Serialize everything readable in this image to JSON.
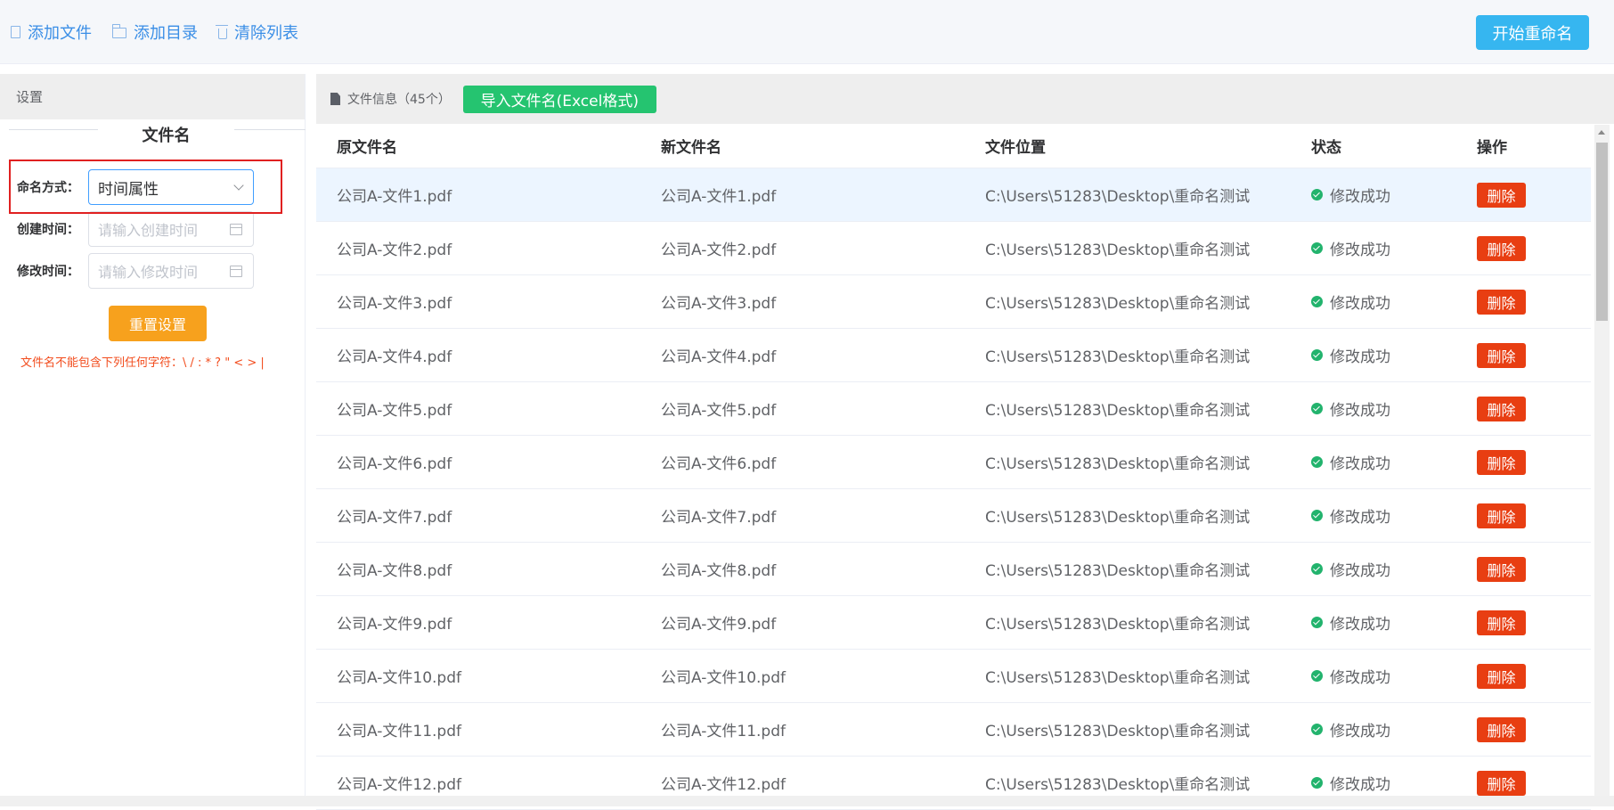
{
  "toolbar": {
    "add_file": "添加文件",
    "add_dir": "添加目录",
    "clear_list": "清除列表",
    "start_rename": "开始重命名"
  },
  "settings": {
    "title": "设置",
    "section_title": "文件名",
    "naming_label": "命名方式：",
    "naming_value": "时间属性",
    "create_time_label": "创建时间：",
    "create_time_placeholder": "请输入创建时间",
    "modify_time_label": "修改时间：",
    "modify_time_placeholder": "请输入修改时间",
    "reset_button": "重置设置",
    "warning": "文件名不能包含下列任何字符：\\ / : * ? \" < > |"
  },
  "file_panel": {
    "title": "文件信息（45个）",
    "import_button": "导入文件名(Excel格式)"
  },
  "table": {
    "headers": [
      "原文件名",
      "新文件名",
      "文件位置",
      "状态",
      "操作"
    ],
    "rows": [
      {
        "original": "公司A-文件1.pdf",
        "new": "公司A-文件1.pdf",
        "location": "C:\\Users\\51283\\Desktop\\重命名测试",
        "status": "修改成功",
        "action": "删除"
      },
      {
        "original": "公司A-文件2.pdf",
        "new": "公司A-文件2.pdf",
        "location": "C:\\Users\\51283\\Desktop\\重命名测试",
        "status": "修改成功",
        "action": "删除"
      },
      {
        "original": "公司A-文件3.pdf",
        "new": "公司A-文件3.pdf",
        "location": "C:\\Users\\51283\\Desktop\\重命名测试",
        "status": "修改成功",
        "action": "删除"
      },
      {
        "original": "公司A-文件4.pdf",
        "new": "公司A-文件4.pdf",
        "location": "C:\\Users\\51283\\Desktop\\重命名测试",
        "status": "修改成功",
        "action": "删除"
      },
      {
        "original": "公司A-文件5.pdf",
        "new": "公司A-文件5.pdf",
        "location": "C:\\Users\\51283\\Desktop\\重命名测试",
        "status": "修改成功",
        "action": "删除"
      },
      {
        "original": "公司A-文件6.pdf",
        "new": "公司A-文件6.pdf",
        "location": "C:\\Users\\51283\\Desktop\\重命名测试",
        "status": "修改成功",
        "action": "删除"
      },
      {
        "original": "公司A-文件7.pdf",
        "new": "公司A-文件7.pdf",
        "location": "C:\\Users\\51283\\Desktop\\重命名测试",
        "status": "修改成功",
        "action": "删除"
      },
      {
        "original": "公司A-文件8.pdf",
        "new": "公司A-文件8.pdf",
        "location": "C:\\Users\\51283\\Desktop\\重命名测试",
        "status": "修改成功",
        "action": "删除"
      },
      {
        "original": "公司A-文件9.pdf",
        "new": "公司A-文件9.pdf",
        "location": "C:\\Users\\51283\\Desktop\\重命名测试",
        "status": "修改成功",
        "action": "删除"
      },
      {
        "original": "公司A-文件10.pdf",
        "new": "公司A-文件10.pdf",
        "location": "C:\\Users\\51283\\Desktop\\重命名测试",
        "status": "修改成功",
        "action": "删除"
      },
      {
        "original": "公司A-文件11.pdf",
        "new": "公司A-文件11.pdf",
        "location": "C:\\Users\\51283\\Desktop\\重命名测试",
        "status": "修改成功",
        "action": "删除"
      },
      {
        "original": "公司A-文件12.pdf",
        "new": "公司A-文件12.pdf",
        "location": "C:\\Users\\51283\\Desktop\\重命名测试",
        "status": "修改成功",
        "action": "删除"
      }
    ]
  },
  "icons": {
    "add_file": "file-icon",
    "add_dir": "folder-icon",
    "clear_list": "trash-icon",
    "file_info": "document-icon",
    "status_ok": "check-circle-icon",
    "calendar": "calendar-icon",
    "dropdown": "chevron-down-icon"
  },
  "colors": {
    "link": "#3a8ee6",
    "primary_button": "#36b6f0",
    "import_button": "#25c470",
    "reset_button": "#f7a11d",
    "delete_button": "#e83e12",
    "success": "#22b36d",
    "warning_text": "#f24c1d",
    "highlight_frame": "#e02020"
  }
}
